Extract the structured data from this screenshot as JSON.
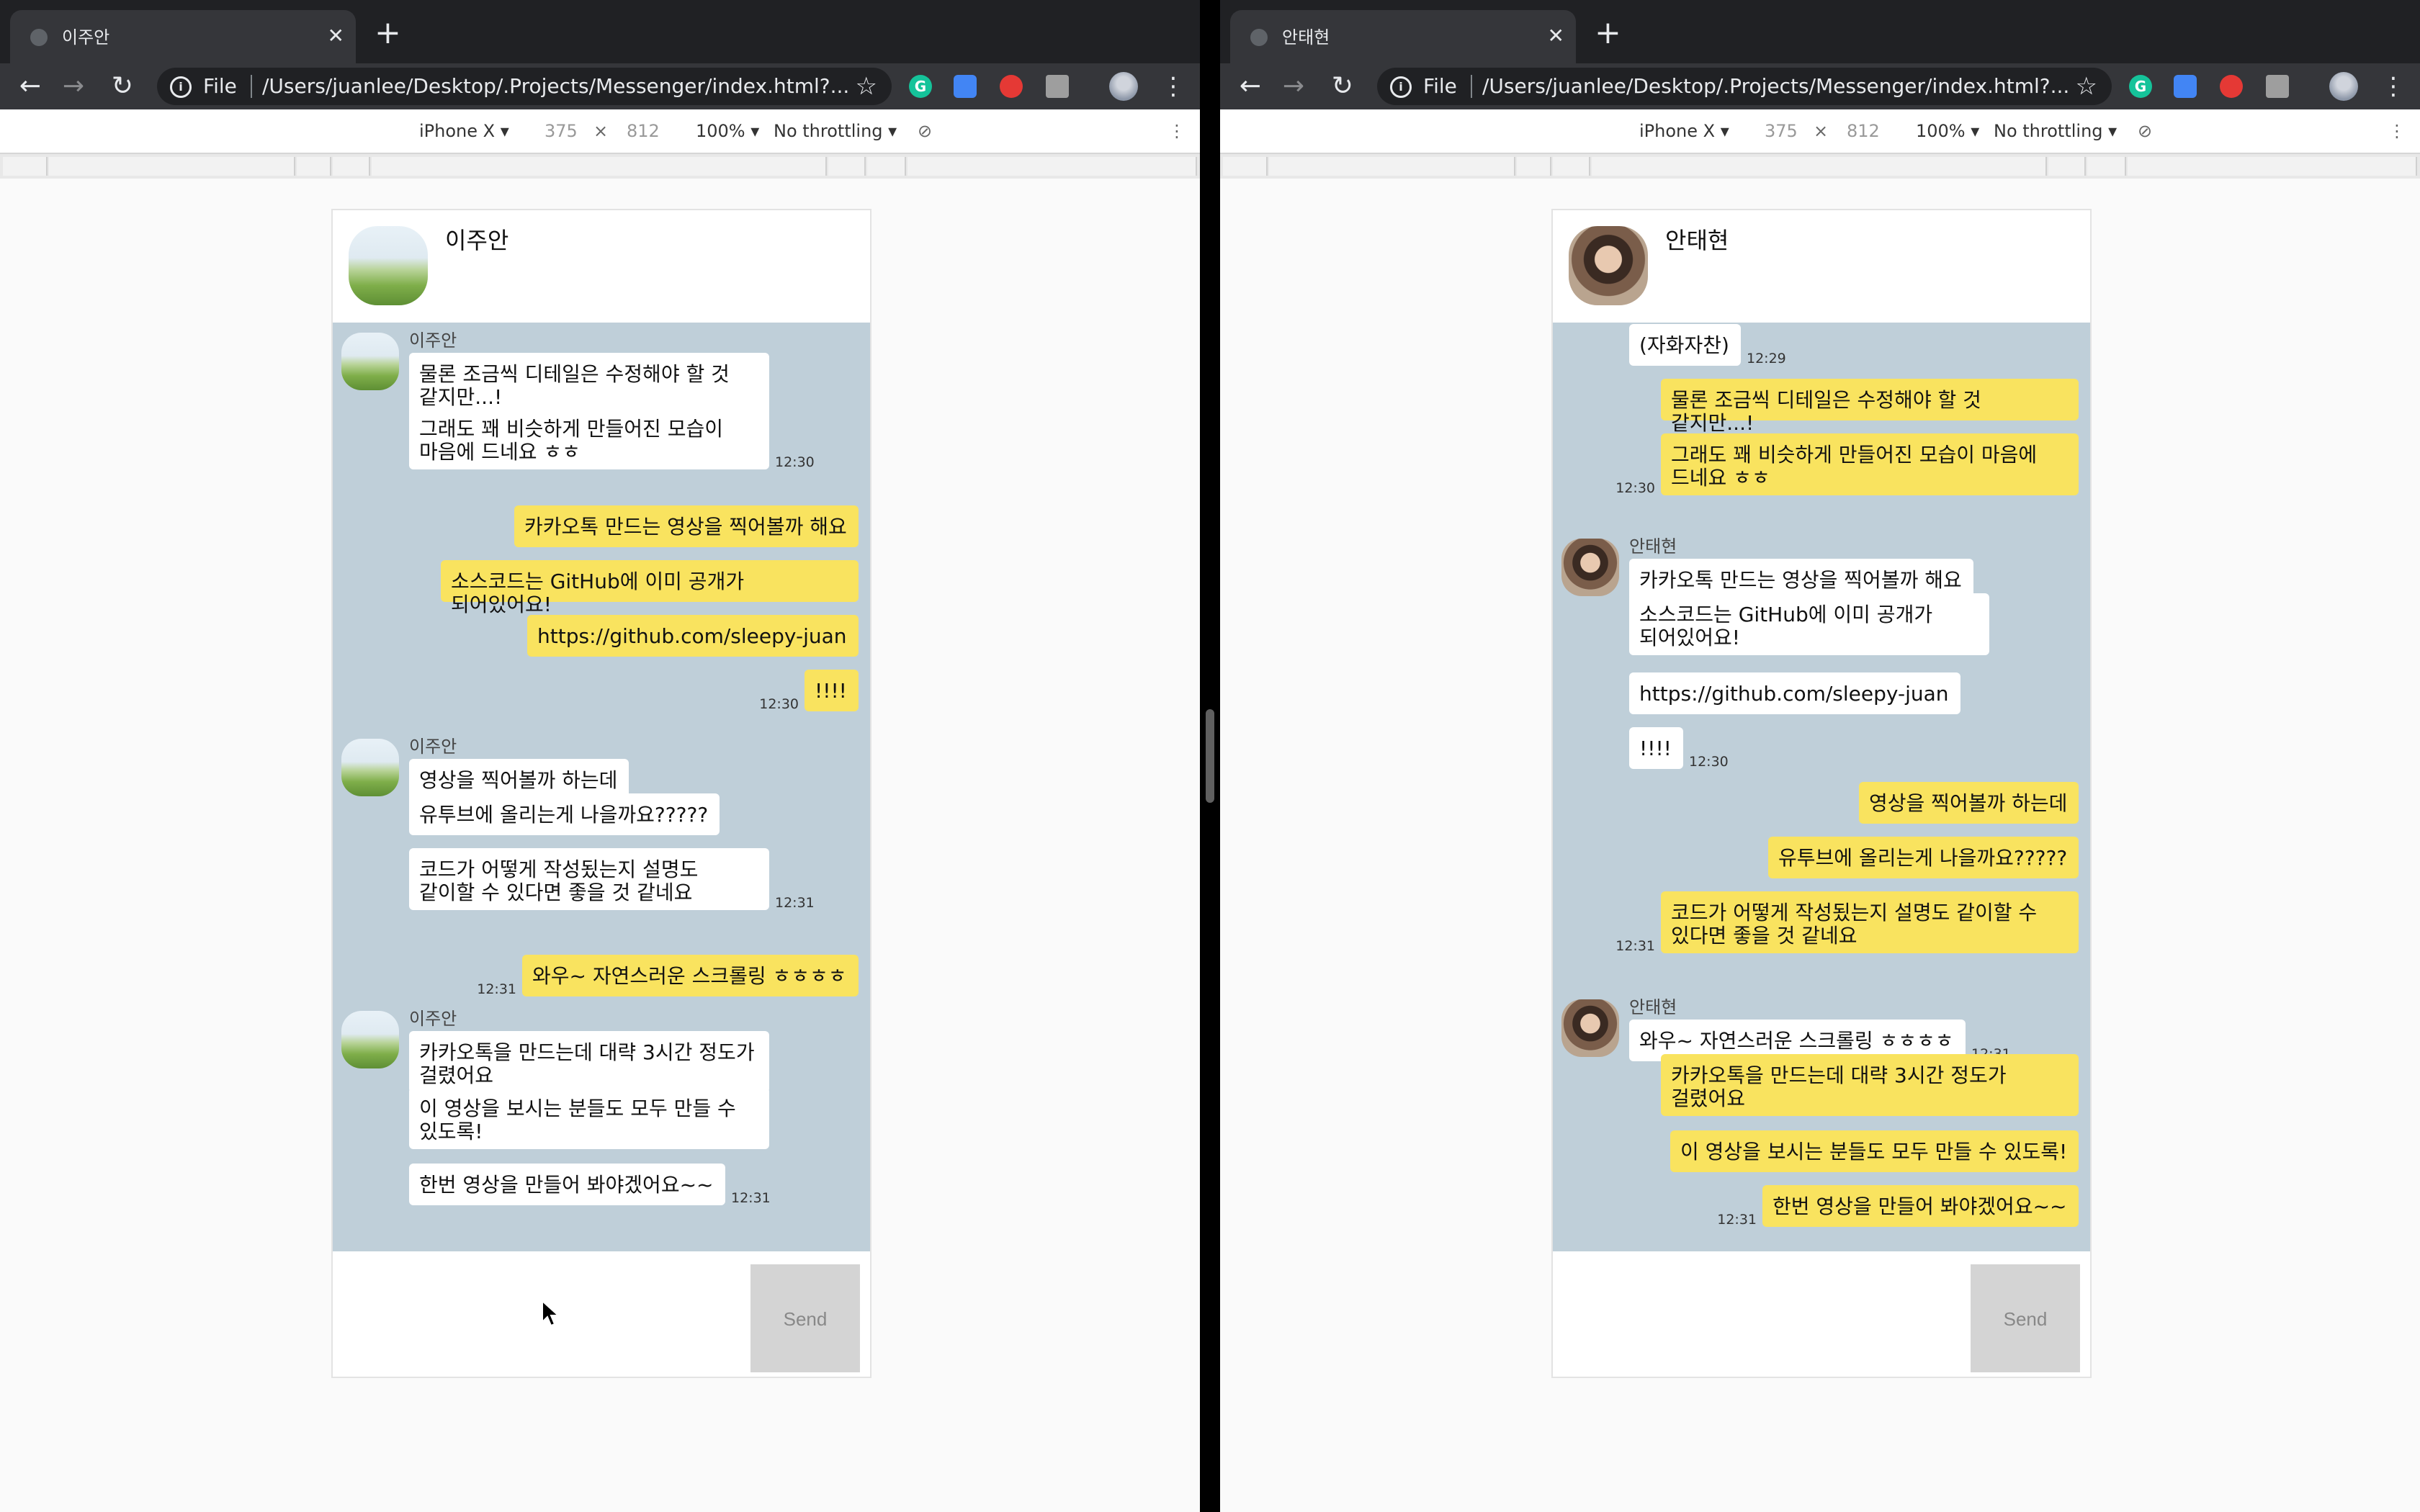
{
  "windows": [
    {
      "tab_title": "이주안",
      "url_scheme": "File",
      "url": "/Users/juanlee/Desktop/.Projects/Messenger/index.html?...",
      "device": {
        "name": "iPhone X",
        "width": "375",
        "height": "812",
        "zoom": "100%",
        "throttle": "No throttling"
      },
      "chat_title": "이주안",
      "avatar": "field",
      "send_label": "Send",
      "messages": [
        {
          "side": "in",
          "sender": "이주안",
          "avatar": "field",
          "text": "물론 조금씩 디테일은 수정해야 할 것 같지만...!"
        },
        {
          "side": "in",
          "text": "그래도 꽤 비슷하게 만들어진 모습이 마음에 드네요 ㅎㅎ",
          "time": "12:30"
        },
        {
          "side": "out",
          "text": "카카오톡 만드는 영상을 찍어볼까 해요"
        },
        {
          "side": "out",
          "text": "소스코드는 GitHub에 이미 공개가 되어있어요!"
        },
        {
          "side": "out",
          "text": "https://github.com/sleepy-juan"
        },
        {
          "side": "out",
          "text": "!!!!",
          "time": "12:30"
        },
        {
          "side": "in",
          "sender": "이주안",
          "avatar": "field",
          "text": "영상을 찍어볼까 하는데"
        },
        {
          "side": "in",
          "text": "유투브에 올리는게 나을까요?????"
        },
        {
          "side": "in",
          "text": "코드가 어떻게 작성됬는지 설명도 같이할 수 있다면 좋을 것 같네요",
          "time": "12:31"
        },
        {
          "side": "out",
          "text": "와우~ 자연스러운 스크롤링 ㅎㅎㅎㅎ",
          "time": "12:31"
        },
        {
          "side": "in",
          "sender": "이주안",
          "avatar": "field",
          "text": "카카오톡을 만드는데 대략 3시간 정도가 걸렸어요"
        },
        {
          "side": "in",
          "text": "이 영상을 보시는 분들도 모두 만들 수 있도록!"
        },
        {
          "side": "in",
          "text": "한번 영상을 만들어 봐야겠어요~~",
          "time": "12:31"
        }
      ]
    },
    {
      "tab_title": "안태현",
      "url_scheme": "File",
      "url": "/Users/juanlee/Desktop/.Projects/Messenger/index.html?...",
      "device": {
        "name": "iPhone X",
        "width": "375",
        "height": "812",
        "zoom": "100%",
        "throttle": "No throttling"
      },
      "chat_title": "안태현",
      "avatar": "man",
      "send_label": "Send",
      "messages": [
        {
          "side": "in",
          "text": "(자화자찬)",
          "time": "12:29"
        },
        {
          "side": "out",
          "text": "물론 조금씩 디테일은 수정해야 할 것 같지만...!"
        },
        {
          "side": "out",
          "text": "그래도 꽤 비슷하게 만들어진 모습이 마음에 드네요 ㅎㅎ",
          "time": "12:30"
        },
        {
          "side": "in",
          "sender": "안태현",
          "avatar": "man",
          "text": "카카오톡 만드는 영상을 찍어볼까 해요"
        },
        {
          "side": "in",
          "text": "소스코드는 GitHub에 이미 공개가 되어있어요!"
        },
        {
          "side": "in",
          "text": "https://github.com/sleepy-juan"
        },
        {
          "side": "in",
          "text": "!!!!",
          "time": "12:30"
        },
        {
          "side": "out",
          "text": "영상을 찍어볼까 하는데"
        },
        {
          "side": "out",
          "text": "유투브에 올리는게 나을까요?????"
        },
        {
          "side": "out",
          "text": "코드가 어떻게 작성됬는지 설명도 같이할 수 있다면 좋을 것 같네요",
          "time": "12:31"
        },
        {
          "side": "in",
          "sender": "안태현",
          "avatar": "man",
          "text": "와우~ 자연스러운 스크롤링 ㅎㅎㅎㅎ",
          "time": "12:31"
        },
        {
          "side": "out",
          "text": "카카오톡을 만드는데 대략 3시간 정도가 걸렸어요"
        },
        {
          "side": "out",
          "text": "이 영상을 보시는 분들도 모두 만들 수 있도록!"
        },
        {
          "side": "out",
          "text": "한번 영상을 만들어 봐야겠어요~~",
          "time": "12:31"
        }
      ]
    }
  ]
}
